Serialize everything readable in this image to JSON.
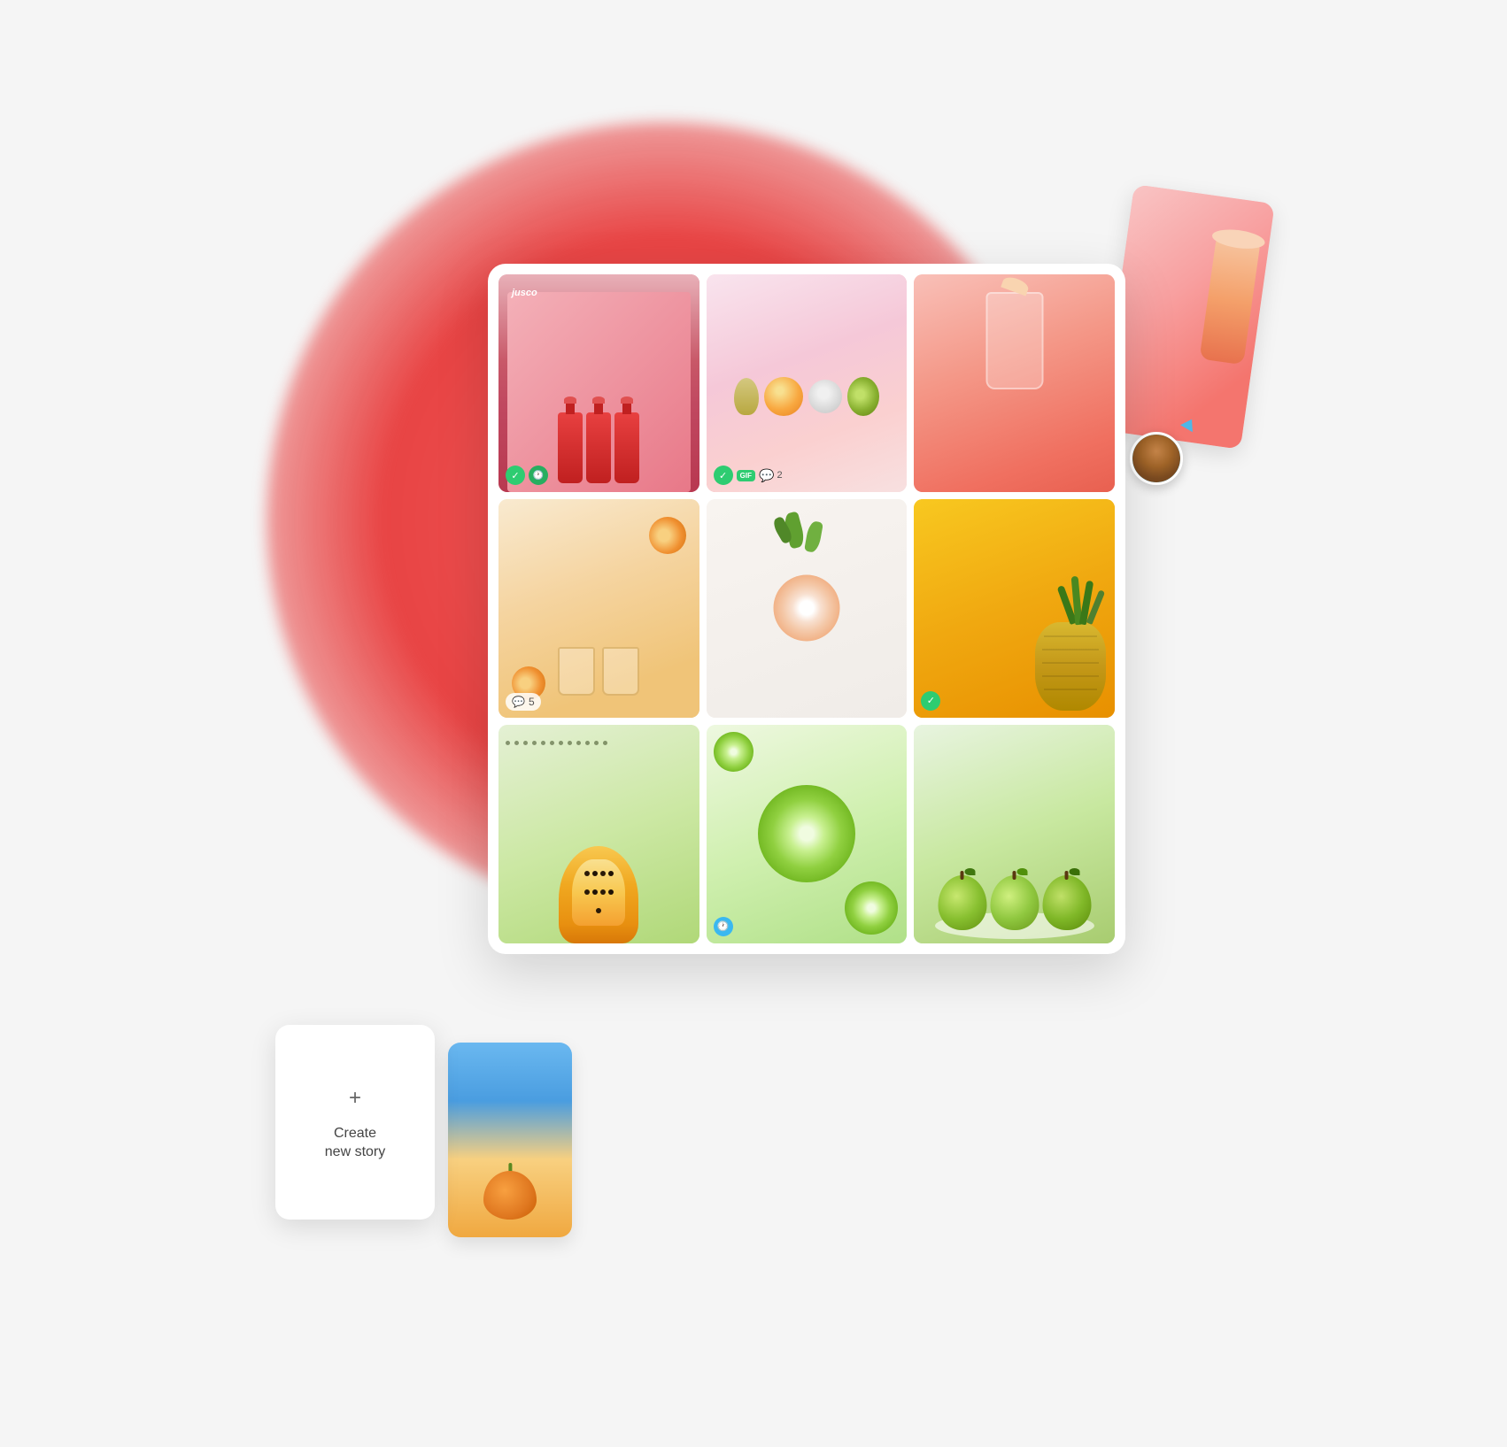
{
  "colors": {
    "red_blob": "#f05a5a",
    "teal_check": "#2ecc71",
    "blue_clock": "#3ab8f0",
    "white": "#ffffff",
    "text_dark": "#444444",
    "text_medium": "#666666"
  },
  "create_story": {
    "plus_icon": "+",
    "label_line1": "Create",
    "label_line2": "new story"
  },
  "cells": [
    {
      "id": "cell-1",
      "type": "bottles",
      "badges": [
        "check",
        "clock"
      ],
      "brand": "jusco"
    },
    {
      "id": "cell-2",
      "type": "fruits",
      "badges": [
        "check",
        "gif",
        "comment"
      ],
      "comment_count": "2"
    },
    {
      "id": "cell-3",
      "type": "drink",
      "badges": [
        "avatar"
      ]
    },
    {
      "id": "cell-4",
      "type": "glasses",
      "badges": [
        "comment"
      ],
      "comment_count": "5"
    },
    {
      "id": "cell-5",
      "type": "herbs",
      "badges": []
    },
    {
      "id": "cell-6",
      "type": "pineapple",
      "badges": [
        "check"
      ]
    },
    {
      "id": "cell-7",
      "type": "papaya",
      "badges": []
    },
    {
      "id": "cell-8",
      "type": "lime",
      "badges": [
        "clock"
      ]
    },
    {
      "id": "cell-9",
      "type": "apples",
      "badges": []
    }
  ],
  "floating_card": {
    "type": "drink_glass"
  }
}
